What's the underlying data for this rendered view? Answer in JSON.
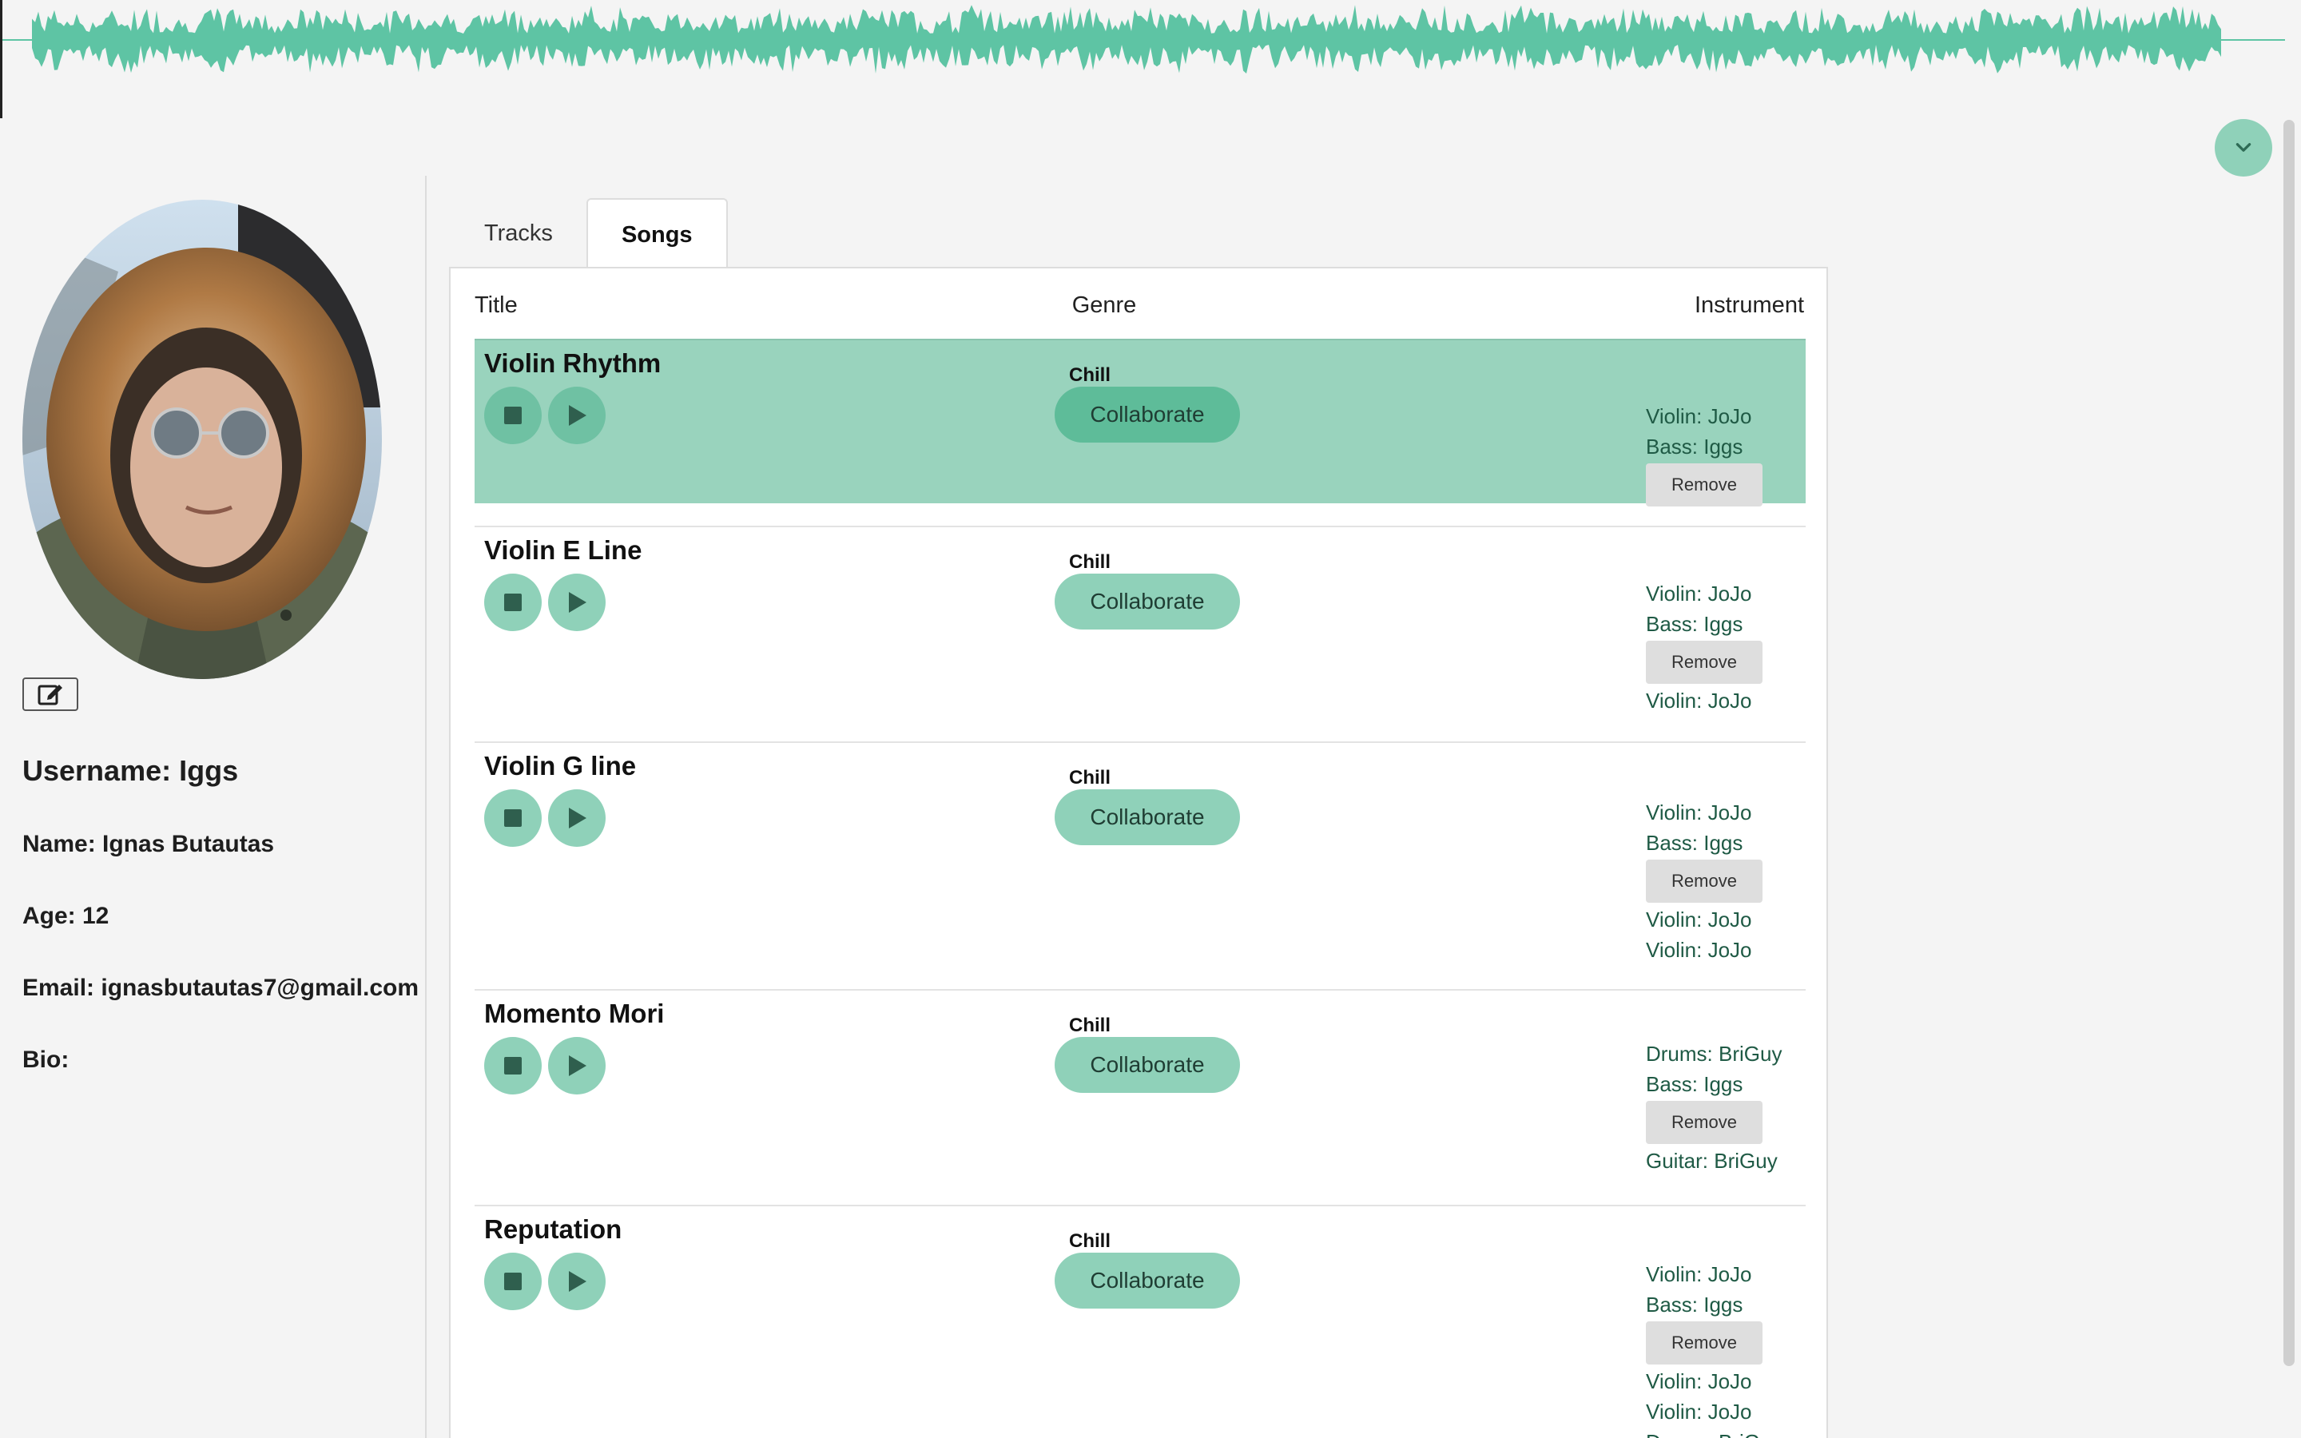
{
  "waveform": {
    "color": "#5ec4a4"
  },
  "profile": {
    "username": "Username: Iggs",
    "name": "Name: Ignas Butautas",
    "age": "Age: 12",
    "email": "Email: ignasbutautas7@gmail.com",
    "bio": "Bio:"
  },
  "tabs": [
    {
      "label": "Tracks",
      "active": false
    },
    {
      "label": "Songs",
      "active": true
    }
  ],
  "table": {
    "headers": {
      "title": "Title",
      "genre": "Genre",
      "instrument": "Instrument"
    },
    "collaborate_label": "Collaborate",
    "remove_label": "Remove",
    "songs": [
      {
        "title": "Violin Rhythm",
        "genre": "Chill",
        "selected": true,
        "instruments_before": [
          "Violin: JoJo",
          "Bass: Iggs"
        ],
        "instruments_after": []
      },
      {
        "title": "Violin E Line",
        "genre": "Chill",
        "selected": false,
        "instruments_before": [
          "Violin: JoJo",
          "Bass: Iggs"
        ],
        "instruments_after": [
          "Violin: JoJo"
        ]
      },
      {
        "title": "Violin G line",
        "genre": "Chill",
        "selected": false,
        "instruments_before": [
          "Violin: JoJo",
          "Bass: Iggs"
        ],
        "instruments_after": [
          "Violin: JoJo",
          "Violin: JoJo"
        ]
      },
      {
        "title": "Momento Mori",
        "genre": "Chill",
        "selected": false,
        "instruments_before": [
          "Drums: BriGuy",
          "Bass: Iggs"
        ],
        "instruments_after": [
          "Guitar: BriGuy"
        ]
      },
      {
        "title": "Reputation",
        "genre": "Chill",
        "selected": false,
        "instruments_before": [
          "Violin: JoJo",
          "Bass: Iggs"
        ],
        "instruments_after": [
          "Violin: JoJo",
          "Violin: JoJo",
          "Drums: BriGuy"
        ]
      }
    ]
  },
  "colors": {
    "accent": "#8fd1b9",
    "selected_row": "#99d3bd",
    "instrument_text": "#1f5a45"
  },
  "icons": {
    "collapse": "chevron-down-icon",
    "edit": "edit-icon",
    "stop": "stop-icon",
    "play": "play-icon"
  }
}
